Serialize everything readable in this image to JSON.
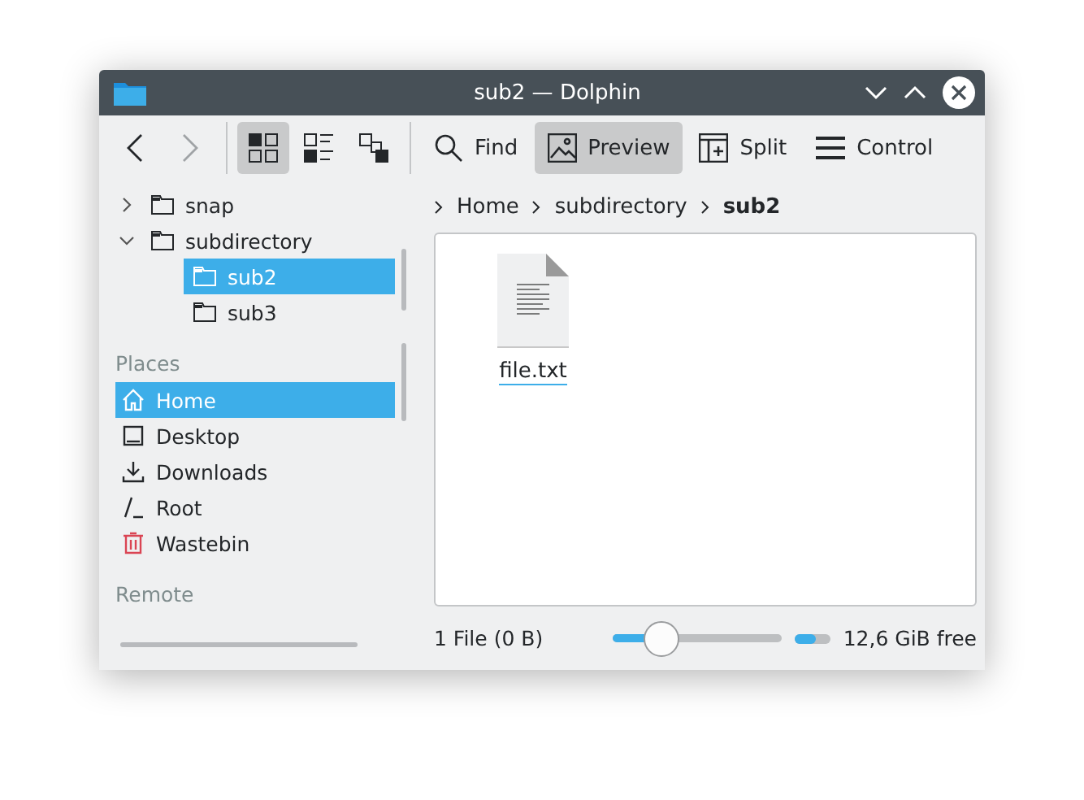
{
  "window": {
    "title": "sub2 — Dolphin"
  },
  "toolbar": {
    "navigation": [
      {
        "kind": "back",
        "disabled": false
      },
      {
        "kind": "forward",
        "disabled": true
      }
    ],
    "view_modes": [
      {
        "kind": "icons",
        "selected": true
      },
      {
        "kind": "compact",
        "selected": false
      },
      {
        "kind": "details",
        "selected": false
      }
    ],
    "actions": [
      {
        "kind": "find",
        "label": "Find",
        "selected": false
      },
      {
        "kind": "preview",
        "label": "Preview",
        "selected": true
      },
      {
        "kind": "split",
        "label": "Split",
        "selected": false
      },
      {
        "kind": "control",
        "label": "Control",
        "selected": false
      }
    ]
  },
  "folder_tree": [
    {
      "label": "snap",
      "expanded": false,
      "selected": false
    },
    {
      "label": "subdirectory",
      "expanded": true,
      "selected": false,
      "children": [
        {
          "label": "sub2",
          "selected": true
        },
        {
          "label": "sub3",
          "selected": false
        }
      ]
    }
  ],
  "places": {
    "heading": "Places",
    "items": [
      {
        "kind": "home",
        "label": "Home",
        "selected": true
      },
      {
        "kind": "desktop",
        "label": "Desktop",
        "selected": false
      },
      {
        "kind": "downloads",
        "label": "Downloads",
        "selected": false
      },
      {
        "kind": "root",
        "label": "Root",
        "selected": false
      },
      {
        "kind": "wastebin",
        "label": "Wastebin",
        "selected": false
      }
    ]
  },
  "remote": {
    "heading": "Remote"
  },
  "breadcrumb": [
    {
      "label": "Home",
      "current": false
    },
    {
      "label": "subdirectory",
      "current": false
    },
    {
      "label": "sub2",
      "current": true
    }
  ],
  "files": [
    {
      "name": "file.txt",
      "focused": true
    }
  ],
  "status_bar": {
    "summary": "1 File (0 B)",
    "zoom": {
      "level": 0.29
    },
    "disk": {
      "level": 0.6,
      "reading": "12,6 GiB free"
    }
  }
}
